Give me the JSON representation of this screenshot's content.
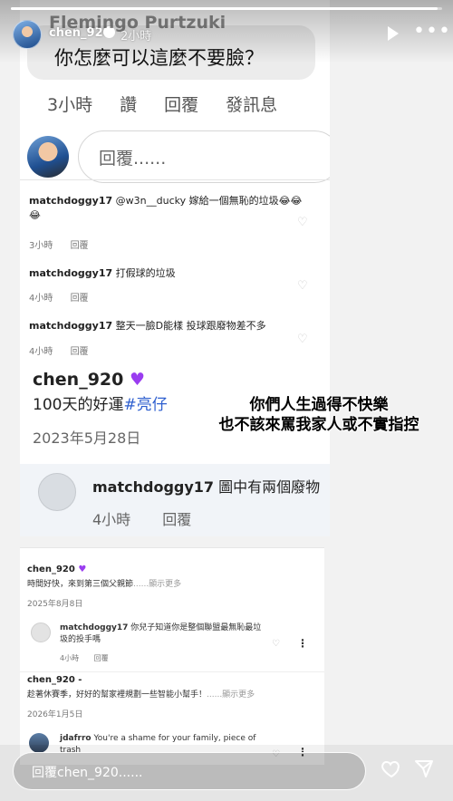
{
  "header": {
    "username": "chen_920",
    "time": "2小時",
    "progress": 0.99
  },
  "shot1": {
    "bubble_author": "Flemingo Purtzuki",
    "bubble_text": "你怎麼可以這麼不要臉？",
    "actions": [
      "3小時",
      "讚",
      "回覆",
      "發訊息"
    ],
    "reply_placeholder": "回覆......",
    "comments": [
      {
        "user": "matchdoggy17",
        "text": "@w3n__ducky 嫁給一個無恥的垃圾😂😂😂",
        "meta": [
          "3小時",
          "回覆"
        ]
      },
      {
        "user": "matchdoggy17",
        "text": "打假球的垃圾",
        "meta": [
          "4小時",
          "回覆"
        ]
      },
      {
        "user": "matchdoggy17",
        "text": "整天一臉D能樣 投球跟廢物差不多",
        "meta": [
          "4小時",
          "回覆"
        ]
      }
    ]
  },
  "shot2": {
    "name": "chen_920",
    "caption": "100天的好運",
    "tag": "#亮仔",
    "date": "2023年5月28日",
    "reply_user": "matchdoggy17",
    "reply_text": "圖中有兩個廢物",
    "reply_meta": [
      "4小時",
      "回覆"
    ]
  },
  "overlay": {
    "line1": "你們人生過得不快樂",
    "line2": "也不該來罵我家人或不實指控"
  },
  "shot3": {
    "post1": {
      "name": "chen_920",
      "text": "時間好快，來到第三個父親節",
      "more": "......顯示更多",
      "date": "2025年8月8日",
      "reply_user": "matchdoggy17",
      "reply_text": "你兒子知道你是整個聯盟最無恥最垃圾的投手嗎",
      "reply_meta": [
        "4小時",
        "回覆"
      ]
    },
    "post2": {
      "name": "chen_920",
      "text": "趁著休賽季，好好的幫家裡規劃一些智能小幫手！",
      "more": "......顯示更多",
      "date": "2026年1月5日",
      "reply_user": "jdafrro",
      "reply_text": "You're a shame for your family, piece of trash"
    }
  },
  "footer": {
    "reply_placeholder": "回覆chen_920......"
  },
  "colors": {
    "tag": "#2e5fcf",
    "purple_heart": "#9a3df0"
  }
}
